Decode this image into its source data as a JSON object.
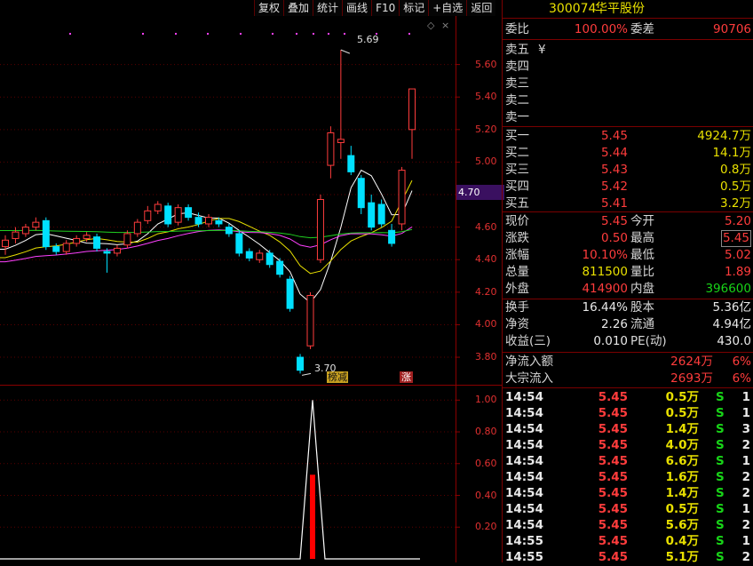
{
  "toolbar": [
    "复权",
    "叠加",
    "统计",
    "画线",
    "F10",
    "标记",
    "+自选",
    "返回"
  ],
  "price_axis": {
    "ticks": [
      "5.60",
      "5.40",
      "5.20",
      "5.00",
      "4.80",
      "4.60",
      "4.40",
      "4.20",
      "4.00",
      "3.80"
    ],
    "current_tag": "4.70",
    "high_marker": "5.69",
    "low_marker": "3.70"
  },
  "chart_tags": {
    "tag1": "榜减",
    "tag2": "涨"
  },
  "volume_axis": {
    "ticks": [
      "1.00",
      "0.80",
      "0.60",
      "0.40",
      "0.20"
    ]
  },
  "stock": {
    "code": "300074",
    "name": "华平股份"
  },
  "order_ratio": {
    "label1": "委比",
    "value1": "100.00%",
    "label2": "委差",
    "value2": "90706"
  },
  "sell_levels": [
    "卖五",
    "卖四",
    "卖三",
    "卖二",
    "卖一"
  ],
  "sell_currency_mark": "¥",
  "buy_levels": [
    {
      "label": "买一",
      "price": "5.45",
      "vol": "4924.7万"
    },
    {
      "label": "买二",
      "price": "5.44",
      "vol": "14.1万"
    },
    {
      "label": "买三",
      "price": "5.43",
      "vol": "0.8万"
    },
    {
      "label": "买四",
      "price": "5.42",
      "vol": "0.5万"
    },
    {
      "label": "买五",
      "price": "5.41",
      "vol": "3.2万"
    }
  ],
  "quote": [
    {
      "l1": "现价",
      "v1": "5.45",
      "l2": "今开",
      "v2": "5.20"
    },
    {
      "l1": "涨跌",
      "v1": "0.50",
      "l2": "最高",
      "v2": "5.45"
    },
    {
      "l1": "涨幅",
      "v1": "10.10%",
      "l2": "最低",
      "v2": "5.02"
    },
    {
      "l1": "总量",
      "v1": "811500",
      "l2": "量比",
      "v2": "1.89"
    },
    {
      "l1": "外盘",
      "v1": "414900",
      "l2": "内盘",
      "v2": "396600"
    }
  ],
  "finance": [
    {
      "l1": "换手",
      "v1": "16.44%",
      "l2": "股本",
      "v2": "5.36亿"
    },
    {
      "l1": "净资",
      "v1": "2.26",
      "l2": "流通",
      "v2": "4.94亿"
    },
    {
      "l1": "收益(三)",
      "v1": "0.010",
      "l2": "PE(动)",
      "v2": "430.0"
    }
  ],
  "flows": [
    {
      "label": "净流入额",
      "value": "2624万",
      "pct": "6%"
    },
    {
      "label": "大宗流入",
      "value": "2693万",
      "pct": "6%"
    }
  ],
  "ticks": [
    {
      "time": "14:54",
      "price": "5.45",
      "vol": "0.5万",
      "side": "S",
      "n": "1"
    },
    {
      "time": "14:54",
      "price": "5.45",
      "vol": "0.5万",
      "side": "S",
      "n": "1"
    },
    {
      "time": "14:54",
      "price": "5.45",
      "vol": "1.4万",
      "side": "S",
      "n": "3"
    },
    {
      "time": "14:54",
      "price": "5.45",
      "vol": "4.0万",
      "side": "S",
      "n": "2"
    },
    {
      "time": "14:54",
      "price": "5.45",
      "vol": "6.6万",
      "side": "S",
      "n": "1"
    },
    {
      "time": "14:54",
      "price": "5.45",
      "vol": "1.6万",
      "side": "S",
      "n": "2"
    },
    {
      "time": "14:54",
      "price": "5.45",
      "vol": "1.4万",
      "side": "S",
      "n": "2"
    },
    {
      "time": "14:54",
      "price": "5.45",
      "vol": "0.5万",
      "side": "S",
      "n": "1"
    },
    {
      "time": "14:54",
      "price": "5.45",
      "vol": "5.6万",
      "side": "S",
      "n": "2"
    },
    {
      "time": "14:55",
      "price": "5.45",
      "vol": "0.4万",
      "side": "S",
      "n": "1"
    },
    {
      "time": "14:55",
      "price": "5.45",
      "vol": "5.1万",
      "side": "S",
      "n": "2"
    }
  ],
  "colors": {
    "up": "#ff3c3c",
    "down": "#00e0ff",
    "ma5": "#ffffff",
    "ma10": "#e8e000",
    "ma20": "#ff40ff",
    "ma60": "#20d020",
    "accent_bar": "#3a1060"
  },
  "candles": [
    {
      "o": 4.48,
      "c": 4.52,
      "h": 4.55,
      "l": 4.43
    },
    {
      "o": 4.53,
      "c": 4.57,
      "h": 4.6,
      "l": 4.5
    },
    {
      "o": 4.56,
      "c": 4.6,
      "h": 4.62,
      "l": 4.54
    },
    {
      "o": 4.6,
      "c": 4.63,
      "h": 4.66,
      "l": 4.58
    },
    {
      "o": 4.64,
      "c": 4.48,
      "h": 4.66,
      "l": 4.46
    },
    {
      "o": 4.48,
      "c": 4.45,
      "h": 4.5,
      "l": 4.43
    },
    {
      "o": 4.45,
      "c": 4.5,
      "h": 4.52,
      "l": 4.43
    },
    {
      "o": 4.5,
      "c": 4.53,
      "h": 4.55,
      "l": 4.48
    },
    {
      "o": 4.53,
      "c": 4.55,
      "h": 4.57,
      "l": 4.51
    },
    {
      "o": 4.54,
      "c": 4.47,
      "h": 4.56,
      "l": 4.45
    },
    {
      "o": 4.45,
      "c": 4.44,
      "h": 4.47,
      "l": 4.32
    },
    {
      "o": 4.44,
      "c": 4.47,
      "h": 4.49,
      "l": 4.42
    },
    {
      "o": 4.49,
      "c": 4.56,
      "h": 4.58,
      "l": 4.47
    },
    {
      "o": 4.56,
      "c": 4.63,
      "h": 4.65,
      "l": 4.54
    },
    {
      "o": 4.64,
      "c": 4.7,
      "h": 4.73,
      "l": 4.62
    },
    {
      "o": 4.7,
      "c": 4.74,
      "h": 4.76,
      "l": 4.68
    },
    {
      "o": 4.73,
      "c": 4.62,
      "h": 4.75,
      "l": 4.6
    },
    {
      "o": 4.63,
      "c": 4.72,
      "h": 4.74,
      "l": 4.61
    },
    {
      "o": 4.72,
      "c": 4.66,
      "h": 4.74,
      "l": 4.64
    },
    {
      "o": 4.66,
      "c": 4.62,
      "h": 4.69,
      "l": 4.6
    },
    {
      "o": 4.62,
      "c": 4.66,
      "h": 4.68,
      "l": 4.6
    },
    {
      "o": 4.64,
      "c": 4.62,
      "h": 4.66,
      "l": 4.6
    },
    {
      "o": 4.6,
      "c": 4.56,
      "h": 4.62,
      "l": 4.54
    },
    {
      "o": 4.56,
      "c": 4.44,
      "h": 4.58,
      "l": 4.42
    },
    {
      "o": 4.45,
      "c": 4.41,
      "h": 4.47,
      "l": 4.39
    },
    {
      "o": 4.4,
      "c": 4.44,
      "h": 4.46,
      "l": 4.38
    },
    {
      "o": 4.44,
      "c": 4.37,
      "h": 4.46,
      "l": 4.35
    },
    {
      "o": 4.39,
      "c": 4.31,
      "h": 4.41,
      "l": 4.29
    },
    {
      "o": 4.28,
      "c": 4.1,
      "h": 4.3,
      "l": 4.08
    },
    {
      "o": 3.8,
      "c": 3.72,
      "h": 3.82,
      "l": 3.7
    },
    {
      "o": 3.87,
      "c": 4.18,
      "h": 4.2,
      "l": 3.85
    },
    {
      "o": 4.4,
      "c": 4.77,
      "h": 4.8,
      "l": 4.38
    },
    {
      "o": 4.98,
      "c": 5.18,
      "h": 5.22,
      "l": 4.9
    },
    {
      "o": 5.12,
      "c": 5.14,
      "h": 5.69,
      "l": 5.02
    },
    {
      "o": 5.04,
      "c": 4.94,
      "h": 5.1,
      "l": 4.92
    },
    {
      "o": 4.9,
      "c": 4.72,
      "h": 4.92,
      "l": 4.68
    },
    {
      "o": 4.75,
      "c": 4.6,
      "h": 4.8,
      "l": 4.58
    },
    {
      "o": 4.74,
      "c": 4.62,
      "h": 4.77,
      "l": 4.6
    },
    {
      "o": 4.58,
      "c": 4.5,
      "h": 4.62,
      "l": 4.48
    },
    {
      "o": 4.62,
      "c": 4.95,
      "h": 4.97,
      "l": 4.58
    },
    {
      "o": 5.2,
      "c": 5.45,
      "h": 5.45,
      "l": 5.02
    }
  ]
}
